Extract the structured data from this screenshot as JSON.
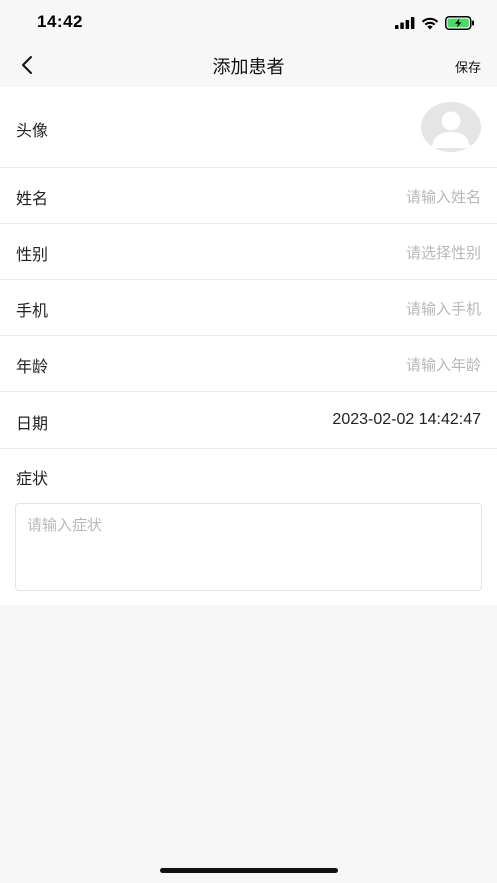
{
  "status": {
    "time": "14:42"
  },
  "nav": {
    "title": "添加患者",
    "save_label": "保存"
  },
  "form": {
    "avatar_label": "头像",
    "name": {
      "label": "姓名",
      "placeholder": "请输入姓名"
    },
    "gender": {
      "label": "性别",
      "placeholder": "请选择性别"
    },
    "phone": {
      "label": "手机",
      "placeholder": "请输入手机"
    },
    "age": {
      "label": "年龄",
      "placeholder": "请输入年龄"
    },
    "date": {
      "label": "日期",
      "value": "2023-02-02 14:42:47"
    },
    "symptom": {
      "label": "症状",
      "placeholder": "请输入症状"
    }
  },
  "icons": {
    "back": "chevron-left-icon",
    "avatar": "user-avatar-icon",
    "signal": "cellular-signal-icon",
    "wifi": "wifi-icon",
    "battery": "battery-charging-icon"
  },
  "colors": {
    "battery_fill": "#4cd964",
    "placeholder": "#b8b8b8"
  }
}
